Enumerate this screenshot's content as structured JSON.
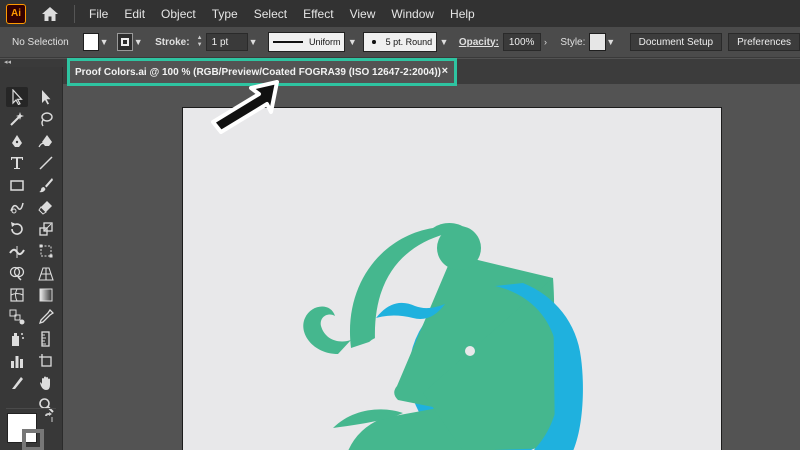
{
  "app": {
    "logo_text": "Ai"
  },
  "menu": [
    "File",
    "Edit",
    "Object",
    "Type",
    "Select",
    "Effect",
    "View",
    "Window",
    "Help"
  ],
  "control_bar": {
    "selection": "No Selection",
    "stroke_label": "Stroke:",
    "stroke_weight": "1 pt",
    "stroke_profile": "Uniform",
    "brush": "5 pt. Round",
    "opacity_label": "Opacity:",
    "opacity_value": "100%",
    "style_label": "Style:",
    "document_setup": "Document Setup",
    "preferences": "Preferences"
  },
  "panel_collapse": "◂◂",
  "document_tab": {
    "title": "Proof Colors.ai @ 100 % (RGB/Preview/Coated FOGRA39 (ISO 12647-2:2004))",
    "close": "×"
  },
  "colors": {
    "highlight": "#2ec4a1",
    "logo_green": "#45b78e",
    "logo_blue": "#1fb1de",
    "artboard": "#e8e8ea"
  },
  "icons": [
    "home-icon",
    "selection-tool-icon",
    "direct-selection-tool-icon",
    "magic-wand-icon",
    "lasso-icon",
    "pen-icon",
    "curvature-icon",
    "type-icon",
    "line-icon",
    "rectangle-icon",
    "paintbrush-icon",
    "shaper-icon",
    "eraser-icon",
    "rotate-icon",
    "scale-icon",
    "width-icon",
    "free-transform-icon",
    "shape-builder-icon",
    "perspective-grid-icon",
    "mesh-icon",
    "gradient-icon",
    "eyedropper-icon",
    "measure-icon",
    "blend-icon",
    "symbol-sprayer-icon",
    "column-graph-icon",
    "artboard-tool-icon",
    "slice-icon",
    "hand-icon",
    "zoom-icon",
    "swap-icon"
  ]
}
